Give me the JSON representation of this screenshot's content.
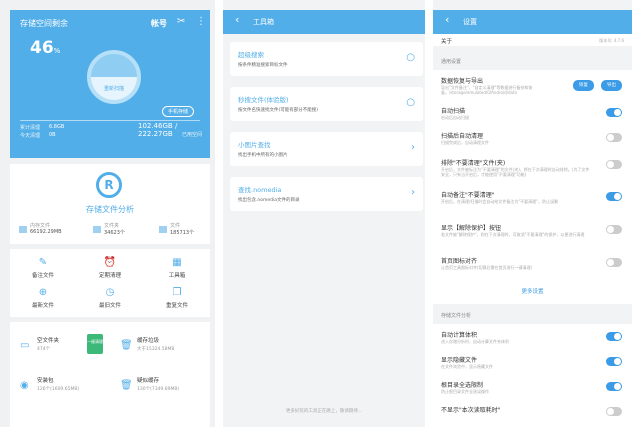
{
  "storage": {
    "title": "存储空间剩余",
    "account": "帐号",
    "percent": "46",
    "percent_unit": "%",
    "ring_label": "重新扫描",
    "phone_storage": "手机存储",
    "cleaned_label": "累计清理",
    "cleaned_value": "6.8GB",
    "today_label": "今天清理",
    "today_value": "0B",
    "used": "102.46GB / 222.27GB",
    "used_label": "已用空间"
  },
  "analysis": {
    "title": "存储文件分析",
    "stats": [
      {
        "k": "内存文件",
        "v": "66192.29MB"
      },
      {
        "k": "文件夹",
        "v": "34623个"
      },
      {
        "k": "文件",
        "v": "185713个"
      }
    ]
  },
  "grid": [
    {
      "label": "备注文件",
      "icon": "edit-icon",
      "glyph": "✎"
    },
    {
      "label": "定期清理",
      "icon": "alarm-icon",
      "glyph": "⏰"
    },
    {
      "label": "工具箱",
      "icon": "toolbox-icon",
      "glyph": "▦"
    },
    {
      "label": "最新文件",
      "icon": "new-file-icon",
      "glyph": "⊕"
    },
    {
      "label": "最旧文件",
      "icon": "old-file-icon",
      "glyph": "◷"
    },
    {
      "label": "重复文件",
      "icon": "duplicate-icon",
      "glyph": "❐"
    }
  ],
  "jobs": [
    {
      "title": "空文件夹",
      "sub": "474个",
      "icon": "folder-icon",
      "glyph": "▭",
      "button": "一键清理"
    },
    {
      "title": "缓存垃圾",
      "sub": "大于15324.58MB",
      "icon": "trash-icon",
      "glyph": "🗑"
    },
    {
      "title": "安装包",
      "sub": "126个(1609.65MB)",
      "icon": "android-icon",
      "glyph": "◉"
    },
    {
      "title": "疑似缓存",
      "sub": "130个(7349.89MB)",
      "icon": "trash-icon",
      "glyph": "🗑"
    }
  ],
  "toolbox": {
    "title": "工具箱",
    "cards": [
      {
        "title": "超级搜索",
        "sub": "按条件精准搜索目标文件",
        "icon": "search-icon",
        "glyph": "○"
      },
      {
        "title": "秒搜文件(体验版)",
        "sub": "按文件名快速找文件(可能有部分不能搜)",
        "icon": "search-icon",
        "glyph": "○"
      },
      {
        "title": "小图片查找",
        "sub": "找出手机中所有的小图片",
        "icon": "chevron-right-icon",
        "glyph": "›"
      },
      {
        "title": "查找.nomedia",
        "sub": "找出包含.nomedia文件的目录",
        "icon": "chevron-right-icon",
        "glyph": "›"
      }
    ],
    "footer": "更多好玩的工具正在路上，敬请期待..."
  },
  "settings": {
    "title": "设置",
    "about": "关于",
    "version": "版本号: 4.7.6",
    "general": "通用设置",
    "backup": {
      "title": "数据恢复与导出",
      "sub": "导出\"文件备注\"、\"自定义清理\"等数据进行备份和恢复。/storage/emulated/0/Android/data",
      "restore": "恢复",
      "export": "导出"
    },
    "rows": [
      {
        "t": "自动扫描",
        "s": "启动后自动扫描",
        "on": true
      },
      {
        "t": "扫描后自动清理",
        "s": "扫描完成后，自动清理文件",
        "on": false
      },
      {
        "t": "排除\"不要清理\"文件(夹)",
        "s": "开启后，文件被标注为\"不要清理\"的文件(夹)，将在下次清理时自动排除。(为了文件安全，只有当开启后，才能使用\"不要清理\"功能)",
        "on": false
      },
      {
        "t": "自动备注\"不要清理\"",
        "s": "开启后，在清理/扫描时会自动给文件备注为\"不要清理\"，防止误删",
        "on": true
      },
      {
        "t": "显示【解除保护】按钮",
        "s": "若文件被\"解除保护\"，则在下次清理时，可取消\"不要清理\"的保护，以便进行清理",
        "on": false
      },
      {
        "t": "首页图标对齐",
        "s": "让首页工具图标对齐(切换后需在首页进行一键清理)",
        "on": false
      }
    ],
    "more": "更多设置",
    "analysis": "存储文件分析",
    "rows2": [
      {
        "t": "自动计算体积",
        "s": "进入存储分析时，自动计算文件夹体积",
        "on": true
      },
      {
        "t": "显示隐藏文件",
        "s": "在文件浏览中，显示隐藏文件",
        "on": true
      },
      {
        "t": "根目录全选限制",
        "s": "防止根目录文件全选误操作",
        "on": true
      },
      {
        "t": "不显示\"本次读取耗时\"",
        "s": "",
        "on": false
      }
    ]
  }
}
